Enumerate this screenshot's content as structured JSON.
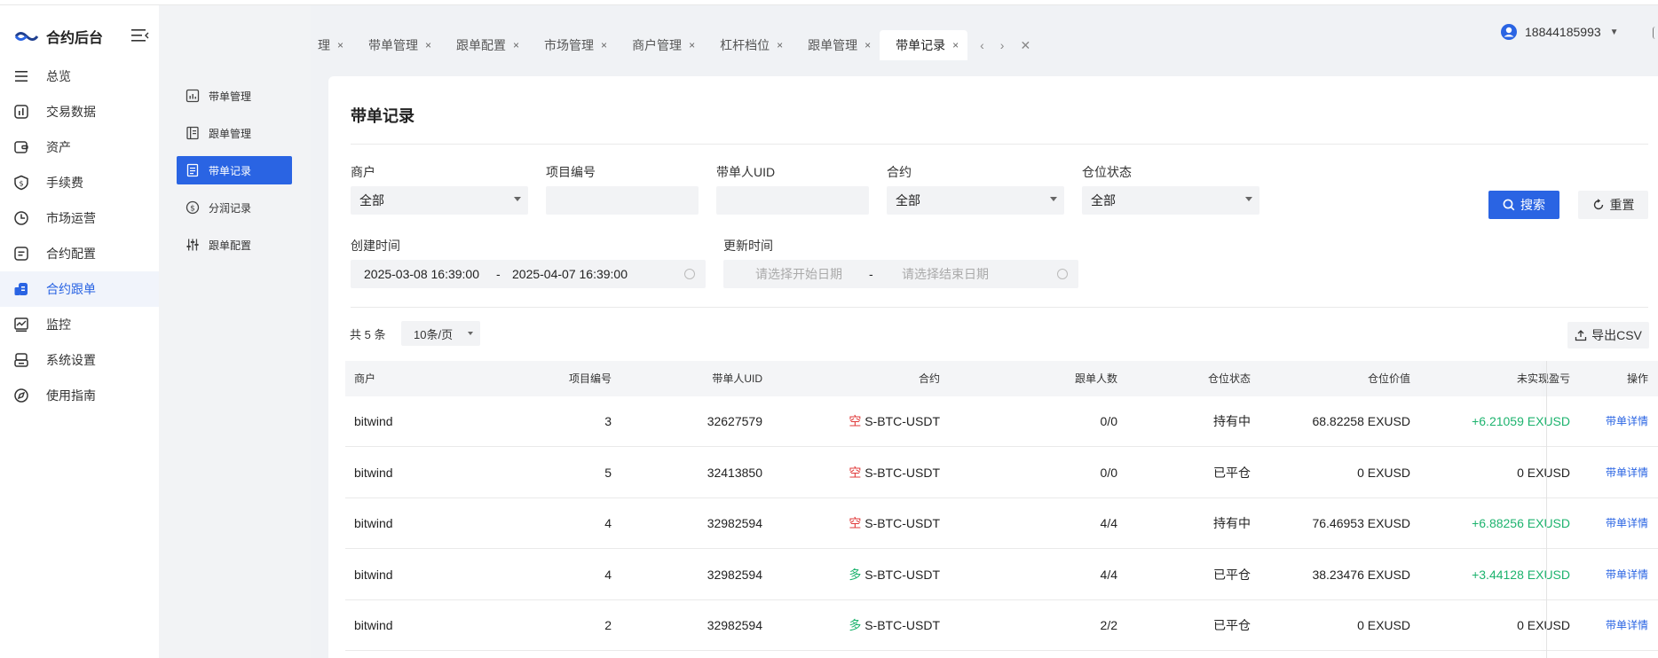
{
  "app": {
    "title": "合约后台"
  },
  "nav": {
    "items": [
      {
        "label": "总览",
        "icon": "list-icon"
      },
      {
        "label": "交易数据",
        "icon": "data-icon"
      },
      {
        "label": "资产",
        "icon": "wallet-icon"
      },
      {
        "label": "手续费",
        "icon": "fee-icon"
      },
      {
        "label": "市场运营",
        "icon": "clock-icon"
      },
      {
        "label": "合约配置",
        "icon": "config-icon"
      },
      {
        "label": "合约跟单",
        "icon": "copy-trade-icon"
      },
      {
        "label": "监控",
        "icon": "monitor-icon"
      },
      {
        "label": "系统设置",
        "icon": "settings-icon"
      },
      {
        "label": "使用指南",
        "icon": "compass-icon"
      }
    ],
    "active_index": 6
  },
  "subnav": {
    "items": [
      {
        "label": "带单管理",
        "icon": "chart-box-icon"
      },
      {
        "label": "跟单管理",
        "icon": "book-icon"
      },
      {
        "label": "带单记录",
        "icon": "document-icon"
      },
      {
        "label": "分润记录",
        "icon": "dollar-icon"
      },
      {
        "label": "跟单配置",
        "icon": "sliders-icon"
      }
    ],
    "active_index": 2
  },
  "tabs": {
    "items": [
      "理",
      "带单管理",
      "跟单配置",
      "市场管理",
      "商户管理",
      "杠杆档位",
      "跟单管理",
      "带单记录"
    ],
    "active_index": 7,
    "close_glyph": "×"
  },
  "user": {
    "name": "18844185993"
  },
  "page": {
    "title": "带单记录"
  },
  "filters": {
    "merchant": {
      "label": "商户",
      "value": "全部"
    },
    "project_no": {
      "label": "项目编号",
      "value": ""
    },
    "leader_uid": {
      "label": "带单人UID",
      "value": ""
    },
    "contract": {
      "label": "合约",
      "value": "全部"
    },
    "position_status": {
      "label": "仓位状态",
      "value": "全部"
    },
    "created_time": {
      "label": "创建时间",
      "start": "2025-03-08 16:39:00",
      "end": "2025-04-07 16:39:00",
      "sep": "-"
    },
    "updated_time": {
      "label": "更新时间",
      "start_placeholder": "请选择开始日期",
      "end_placeholder": "请选择结束日期",
      "sep": "-"
    },
    "search_label": "搜索",
    "reset_label": "重置"
  },
  "table_meta": {
    "total": "共 5 条",
    "page_size": "10条/页",
    "export_label": "导出CSV"
  },
  "table": {
    "columns": [
      "商户",
      "项目编号",
      "带单人UID",
      "合约",
      "跟单人数",
      "仓位状态",
      "仓位价值",
      "未实现盈亏",
      "操作"
    ],
    "rows": [
      {
        "merchant": "bitwind",
        "project": "3",
        "uid": "32627579",
        "dir": "空",
        "contract": "S-BTC-USDT",
        "followers": "0/0",
        "status": "持有中",
        "value": "68.82258 EXUSD",
        "pnl": "+6.21059 EXUSD",
        "pnl_positive": true,
        "action": "带单详情"
      },
      {
        "merchant": "bitwind",
        "project": "5",
        "uid": "32413850",
        "dir": "空",
        "contract": "S-BTC-USDT",
        "followers": "0/0",
        "status": "已平仓",
        "value": "0 EXUSD",
        "pnl": "0 EXUSD",
        "pnl_positive": false,
        "action": "带单详情"
      },
      {
        "merchant": "bitwind",
        "project": "4",
        "uid": "32982594",
        "dir": "空",
        "contract": "S-BTC-USDT",
        "followers": "4/4",
        "status": "持有中",
        "value": "76.46953 EXUSD",
        "pnl": "+6.88256 EXUSD",
        "pnl_positive": true,
        "action": "带单详情"
      },
      {
        "merchant": "bitwind",
        "project": "4",
        "uid": "32982594",
        "dir": "多",
        "contract": "S-BTC-USDT",
        "followers": "4/4",
        "status": "已平仓",
        "value": "38.23476 EXUSD",
        "pnl": "+3.44128 EXUSD",
        "pnl_positive": true,
        "action": "带单详情"
      },
      {
        "merchant": "bitwind",
        "project": "2",
        "uid": "32982594",
        "dir": "多",
        "contract": "S-BTC-USDT",
        "followers": "2/2",
        "status": "已平仓",
        "value": "0 EXUSD",
        "pnl": "0 EXUSD",
        "pnl_positive": false,
        "action": "带单详情"
      }
    ]
  },
  "colors": {
    "accent": "#2a64e3",
    "positive": "#1db36e",
    "short": "#e03b3b"
  }
}
